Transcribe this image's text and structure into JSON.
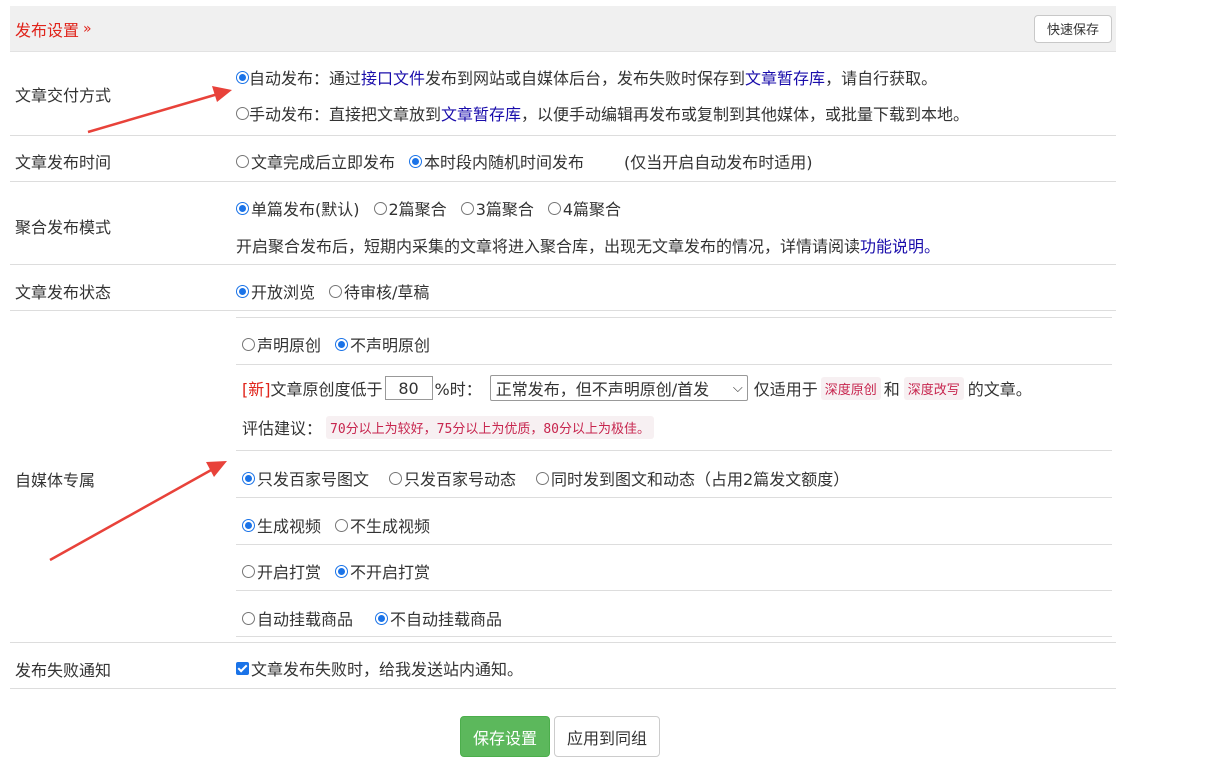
{
  "header": {
    "title": "发布设置",
    "quick_save": "快速保存"
  },
  "delivery": {
    "label": "文章交付方式",
    "auto": {
      "label": "自动发布：通过",
      "link": "接口文件",
      "mid": "发布到网站或自媒体后台，发布失败时保存到",
      "link2": "文章暂存库",
      "tail": "，请自行获取。"
    },
    "manual": {
      "label": "手动发布：直接把文章放到",
      "link": "文章暂存库",
      "tail": "，以便手动编辑再发布或复制到其他媒体，或批量下载到本地。"
    }
  },
  "publish_time": {
    "label": "文章发布时间",
    "opt1": "文章完成后立即发布",
    "opt2": "本时段内随机时间发布",
    "note": "(仅当开启自动发布时适用)"
  },
  "aggregate": {
    "label": "聚合发布模式",
    "options": [
      "单篇发布(默认)",
      "2篇聚合",
      "3篇聚合",
      "4篇聚合"
    ],
    "desc": "开启聚合发布后，短期内采集的文章将进入聚合库，出现无文章发布的情况，详情请阅读",
    "desc_link": "功能说明。"
  },
  "status": {
    "label": "文章发布状态",
    "options": [
      "开放浏览",
      "待审核/草稿"
    ]
  },
  "media": {
    "label": "自媒体专属",
    "original": {
      "opt1": "声明原创",
      "opt2": "不声明原创"
    },
    "originality": {
      "new_tag": "[新]",
      "text1": "文章原创度低于",
      "value": "80",
      "text2": "%时：",
      "select_value": "正常发布，但不声明原创/首发",
      "text3": "仅适用于",
      "code1": "深度原创",
      "and": "和",
      "code2": "深度改写",
      "text4": "的文章。"
    },
    "advice": {
      "label": "评估建议：",
      "code": "70分以上为较好，75分以上为优质，80分以上为极佳。"
    },
    "target": {
      "opt1": "只发百家号图文",
      "opt2": "只发百家号动态",
      "opt3": "同时发到图文和动态（占用2篇发文额度）"
    },
    "video": {
      "opt1": "生成视频",
      "opt2": "不生成视频"
    },
    "reward": {
      "opt1": "开启打赏",
      "opt2": "不开启打赏"
    },
    "goods": {
      "opt1": "自动挂载商品",
      "opt2": "不自动挂载商品"
    }
  },
  "fail_notify": {
    "label": "发布失败通知",
    "text": "文章发布失败时，给我发送站内通知。"
  },
  "buttons": {
    "save": "保存设置",
    "apply": "应用到同组"
  },
  "colors": {
    "accent": "#1a73e8",
    "header_red": "#e0241b",
    "save_green": "#5cb85c",
    "arrow_red": "#e8423a"
  }
}
